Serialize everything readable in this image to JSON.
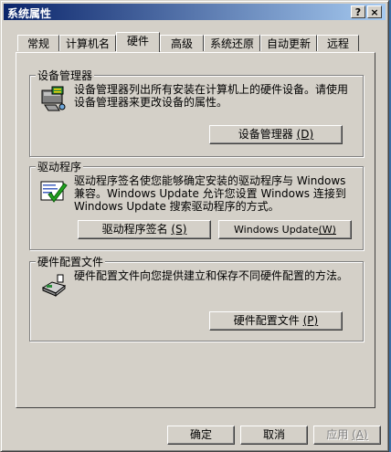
{
  "window": {
    "title": "系统属性",
    "help_btn": "?",
    "close_btn": "×"
  },
  "tabs": [
    "常规",
    "计算机名",
    "硬件",
    "高级",
    "系统还原",
    "自动更新",
    "远程"
  ],
  "active_tab": "硬件",
  "device_manager": {
    "title": "设备管理器",
    "desc": "设备管理器列出所有安装在计算机上的硬件设备。请使用设备管理器来更改设备的属性。",
    "button": "设备管理器",
    "button_key": "(D)"
  },
  "driver": {
    "title": "驱动程序",
    "desc": "驱动程序签名使您能够确定安装的驱动程序与 Windows 兼容。Windows Update 允许您设置 Windows 连接到 Windows Update 搜索驱动程序的方式。",
    "sign_button": "驱动程序签名",
    "sign_key": "(S)",
    "update_button": "Windows Update",
    "update_key": "(W)"
  },
  "profiles": {
    "title": "硬件配置文件",
    "desc": "硬件配置文件向您提供建立和保存不同硬件配置的方法。",
    "button": "硬件配置文件",
    "button_key": "(P)"
  },
  "footer": {
    "ok": "确定",
    "cancel": "取消",
    "apply": "应用",
    "apply_key": "(A)"
  }
}
